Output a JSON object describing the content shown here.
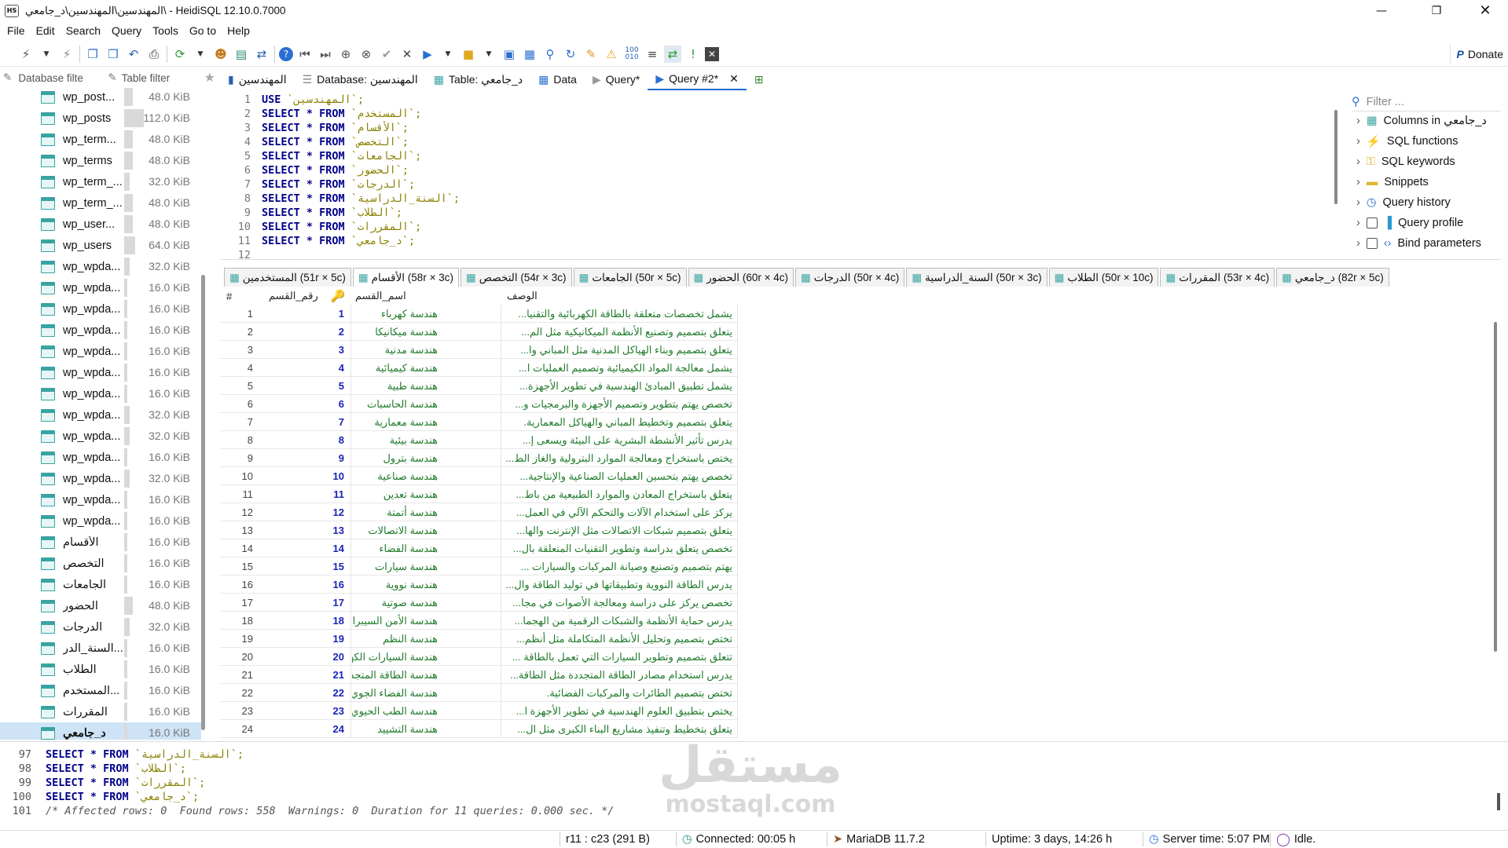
{
  "window": {
    "title": "المهندسين\\المهندسين\\د_جامعي\\ - HeidiSQL 12.10.0.7000",
    "app_icon": "HS"
  },
  "menu": [
    "File",
    "Edit",
    "Search",
    "Query",
    "Tools",
    "Go to",
    "Help"
  ],
  "donate": "Donate",
  "filters": {
    "database": "Database filte",
    "table": "Table filter"
  },
  "tabs": [
    {
      "label": "المهندسين",
      "icon": "server-icon"
    },
    {
      "label": "Database: المهندسين",
      "icon": "database-icon"
    },
    {
      "label": "Table: د_جامعي",
      "icon": "table-icon"
    },
    {
      "label": "Data",
      "icon": "grid-icon"
    },
    {
      "label": "Query*",
      "icon": "play-icon"
    },
    {
      "label": "Query #2*",
      "icon": "play-icon"
    }
  ],
  "tree": [
    {
      "name": "wp_post...",
      "size": "48.0 KiB",
      "fill": 0.12
    },
    {
      "name": "wp_posts",
      "size": "112.0 KiB",
      "fill": 0.28
    },
    {
      "name": "wp_term...",
      "size": "48.0 KiB",
      "fill": 0.12
    },
    {
      "name": "wp_terms",
      "size": "48.0 KiB",
      "fill": 0.12
    },
    {
      "name": "wp_term_...",
      "size": "32.0 KiB",
      "fill": 0.08
    },
    {
      "name": "wp_term_...",
      "size": "48.0 KiB",
      "fill": 0.12
    },
    {
      "name": "wp_user...",
      "size": "48.0 KiB",
      "fill": 0.12
    },
    {
      "name": "wp_users",
      "size": "64.0 KiB",
      "fill": 0.16
    },
    {
      "name": "wp_wpda...",
      "size": "32.0 KiB",
      "fill": 0.08
    },
    {
      "name": "wp_wpda...",
      "size": "16.0 KiB",
      "fill": 0.04
    },
    {
      "name": "wp_wpda...",
      "size": "16.0 KiB",
      "fill": 0.04
    },
    {
      "name": "wp_wpda...",
      "size": "16.0 KiB",
      "fill": 0.04
    },
    {
      "name": "wp_wpda...",
      "size": "16.0 KiB",
      "fill": 0.04
    },
    {
      "name": "wp_wpda...",
      "size": "16.0 KiB",
      "fill": 0.04
    },
    {
      "name": "wp_wpda...",
      "size": "16.0 KiB",
      "fill": 0.04
    },
    {
      "name": "wp_wpda...",
      "size": "32.0 KiB",
      "fill": 0.08
    },
    {
      "name": "wp_wpda...",
      "size": "32.0 KiB",
      "fill": 0.08
    },
    {
      "name": "wp_wpda...",
      "size": "16.0 KiB",
      "fill": 0.04
    },
    {
      "name": "wp_wpda...",
      "size": "32.0 KiB",
      "fill": 0.08
    },
    {
      "name": "wp_wpda...",
      "size": "16.0 KiB",
      "fill": 0.04
    },
    {
      "name": "wp_wpda...",
      "size": "16.0 KiB",
      "fill": 0.04
    },
    {
      "name": "الأقسام",
      "size": "16.0 KiB",
      "fill": 0.04
    },
    {
      "name": "التخصص",
      "size": "16.0 KiB",
      "fill": 0.04
    },
    {
      "name": "الجامعات",
      "size": "16.0 KiB",
      "fill": 0.04
    },
    {
      "name": "الحضور",
      "size": "48.0 KiB",
      "fill": 0.12
    },
    {
      "name": "الدرجات",
      "size": "32.0 KiB",
      "fill": 0.08
    },
    {
      "name": "السنة_الدر...",
      "size": "16.0 KiB",
      "fill": 0.04
    },
    {
      "name": "الطلاب",
      "size": "16.0 KiB",
      "fill": 0.04
    },
    {
      "name": "المستخدم...",
      "size": "16.0 KiB",
      "fill": 0.04
    },
    {
      "name": "المقررات",
      "size": "16.0 KiB",
      "fill": 0.04
    },
    {
      "name": "د_جامعي",
      "size": "16.0 KiB",
      "fill": 0.04,
      "selected": true
    }
  ],
  "editor": [
    {
      "n": "1",
      "kw": "USE ",
      "rest": "`المهندسين`;"
    },
    {
      "n": "2",
      "kw": "SELECT * FROM ",
      "rest": "`المستخدم`;"
    },
    {
      "n": "3",
      "kw": "SELECT * FROM ",
      "rest": "`الأقسام`;"
    },
    {
      "n": "4",
      "kw": "SELECT * FROM ",
      "rest": "`التخصص`;"
    },
    {
      "n": "5",
      "kw": "SELECT * FROM ",
      "rest": "`الجامعات`;"
    },
    {
      "n": "6",
      "kw": "SELECT * FROM ",
      "rest": "`الحضور`;"
    },
    {
      "n": "7",
      "kw": "SELECT * FROM ",
      "rest": "`الدرجات`;"
    },
    {
      "n": "8",
      "kw": "SELECT * FROM ",
      "rest": "`السنة_الدراسية`;"
    },
    {
      "n": "9",
      "kw": "SELECT * FROM ",
      "rest": "`الطلاب`;"
    },
    {
      "n": "10",
      "kw": "SELECT * FROM ",
      "rest": "`المقررات`;"
    },
    {
      "n": "11",
      "kw": "SELECT * FROM ",
      "rest": "`د_جامعي`;"
    },
    {
      "n": "12",
      "kw": "",
      "rest": ""
    }
  ],
  "helpers": {
    "filter_placeholder": "Filter ...",
    "items": [
      {
        "label": "Columns in د_جامعي",
        "icon": "columns-icon"
      },
      {
        "label": "SQL functions",
        "icon": "function-icon"
      },
      {
        "label": "SQL keywords",
        "icon": "key-icon"
      },
      {
        "label": "Snippets",
        "icon": "folder-icon"
      },
      {
        "label": "Query history",
        "icon": "clock-icon"
      },
      {
        "label": "Query profile",
        "icon": "chart-icon",
        "checkbox": true
      },
      {
        "label": "Bind parameters",
        "icon": "code-icon",
        "checkbox": true
      }
    ]
  },
  "result_tabs": [
    "المستخدمين (51r × 5c)",
    "الأقسام (58r × 3c)",
    "التخصص (54r × 3c)",
    "الجامعات (50r × 5c)",
    "الحضور (60r × 4c)",
    "الدرجات (50r × 4c)",
    "السنة_الدراسية (50r × 3c)",
    "الطلاب (50r × 10c)",
    "المقررات (53r × 4c)",
    "د_جامعي (82r × 5c)"
  ],
  "grid": {
    "headers": [
      "#",
      "رقم_القسم",
      "اسم_القسم",
      "الوصف"
    ],
    "rows": [
      [
        "1",
        "1",
        "هندسة كهرباء",
        "يشمل تخصصات متعلقة بالطاقة الكهربائية والتقنيا..."
      ],
      [
        "2",
        "2",
        "هندسة ميكانيكا",
        "يتعلق بتصميم وتصنيع الأنظمة الميكانيكية مثل الم..."
      ],
      [
        "3",
        "3",
        "هندسة مدنية",
        "يتعلق بتصميم وبناء الهياكل المدنية مثل المباني وا..."
      ],
      [
        "4",
        "4",
        "هندسة كيميائية",
        "يشمل معالجة المواد الكيميائية وتصميم العمليات ا..."
      ],
      [
        "5",
        "5",
        "هندسة طبية",
        "يشمل تطبيق المبادئ الهندسية في تطوير الأجهزة..."
      ],
      [
        "6",
        "6",
        "هندسة الحاسبات",
        "تخصص يهتم بتطوير وتصميم الأجهزة والبرمجيات و..."
      ],
      [
        "7",
        "7",
        "هندسة معمارية",
        "يتعلق بتصميم وتخطيط المباني والهياكل المعمارية."
      ],
      [
        "8",
        "8",
        "هندسة بيئية",
        "يدرس تأثير الأنشطة البشرية على البيئة ويسعى إ..."
      ],
      [
        "9",
        "9",
        "هندسة بترول",
        "يختص باستخراج ومعالجة الموارد البترولية والغاز الط..."
      ],
      [
        "10",
        "10",
        "هندسة صناعية",
        "تخصص يهتم بتحسين العمليات الصناعية والإنتاجية..."
      ],
      [
        "11",
        "11",
        "هندسة تعدين",
        "يتعلق باستخراج المعادن والموارد الطبيعية من باط..."
      ],
      [
        "12",
        "12",
        "هندسة أتمتة",
        "يركز على استخدام الآلات والتحكم الآلي في العمل..."
      ],
      [
        "13",
        "13",
        "هندسة الاتصالات",
        "يتعلق بتصميم شبكات الاتصالات مثل الإنترنت والها..."
      ],
      [
        "14",
        "14",
        "هندسة الفضاء",
        "تخصص يتعلق بدراسة وتطوير التقنيات المتعلقة بال..."
      ],
      [
        "15",
        "15",
        "هندسة سيارات",
        "يهتم بتصميم وتصنيع وصيانة المركبات والسيارات ..."
      ],
      [
        "16",
        "16",
        "هندسة نووية",
        "يدرس الطاقة النووية وتطبيقاتها في توليد الطاقة وال..."
      ],
      [
        "17",
        "17",
        "هندسة صوتية",
        "تخصص يركز على دراسة ومعالجة الأصوات في مجا..."
      ],
      [
        "18",
        "18",
        "هندسة الأمن السيبراني",
        "يدرس حماية الأنظمة والشبكات الرقمية من الهجما..."
      ],
      [
        "19",
        "19",
        "هندسة النظم",
        "تختص بتصميم وتحليل الأنظمة المتكاملة مثل أنظم..."
      ],
      [
        "20",
        "20",
        "هندسة السيارات الكهربائية",
        "تتعلق بتصميم وتطوير السيارات التي تعمل بالطاقة ..."
      ],
      [
        "21",
        "21",
        "هندسة الطاقة المتجددة",
        "يدرس استخدام مصادر الطاقة المتجددة مثل الطاقة..."
      ],
      [
        "22",
        "22",
        "هندسة الفضاء الجوي",
        "تختص بتصميم الطائرات والمركبات الفضائية."
      ],
      [
        "23",
        "23",
        "هندسة الطب الحيوي",
        "يختص بتطبيق العلوم الهندسية في تطوير الأجهزة ا..."
      ],
      [
        "24",
        "24",
        "هندسة التشييد",
        "يتعلق بتخطيط وتنفيذ مشاريع البناء الكبرى مثل ال..."
      ]
    ]
  },
  "log": [
    {
      "n": "97",
      "kw": "SELECT * FROM ",
      "rest": "`السنة_الدراسية`;"
    },
    {
      "n": "98",
      "kw": "SELECT * FROM ",
      "rest": "`الطلاب`;"
    },
    {
      "n": "99",
      "kw": "SELECT * FROM ",
      "rest": "`المقررات`;"
    },
    {
      "n": "100",
      "kw": "SELECT * FROM ",
      "rest": "`د_جامعي`;"
    },
    {
      "n": "101",
      "kw": "",
      "rest": "/* Affected rows: 0  Found rows: 558  Warnings: 0  Duration for 11 queries: 0.000 sec. */"
    }
  ],
  "status": {
    "pos": "r11 : c23 (291 B)",
    "connected": "Connected: 00:05 h",
    "server": "MariaDB 11.7.2",
    "uptime": "Uptime: 3 days, 14:26 h",
    "time": "Server time: 5:07 PM",
    "state": "Idle."
  },
  "watermark": {
    "arabic": "مستقل",
    "latin": "mostaql.com"
  }
}
